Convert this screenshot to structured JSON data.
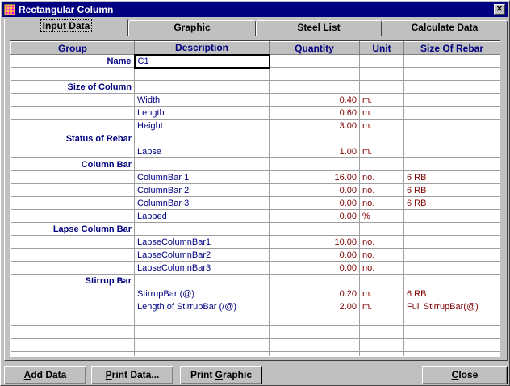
{
  "window": {
    "title": "Rectangular Column",
    "close_label": "✕"
  },
  "tabs": [
    {
      "label": "Input Data",
      "active": true
    },
    {
      "label": "Graphic",
      "active": false
    },
    {
      "label": "Steel List",
      "active": false
    },
    {
      "label": "Calculate Data",
      "active": false
    }
  ],
  "grid": {
    "headers": [
      "Group",
      "Description",
      "Quantity",
      "Unit",
      "Size Of Rebar"
    ],
    "rows": [
      {
        "group": "Name",
        "description": "C1",
        "quantity": "",
        "unit": "",
        "rebar": ""
      },
      {
        "group": "",
        "description": "",
        "quantity": "",
        "unit": "",
        "rebar": ""
      },
      {
        "group": "Size of Column",
        "description": "",
        "quantity": "",
        "unit": "",
        "rebar": ""
      },
      {
        "group": "",
        "description": "Width",
        "quantity": "0.40",
        "unit": "m.",
        "rebar": ""
      },
      {
        "group": "",
        "description": "Length",
        "quantity": "0.60",
        "unit": "m.",
        "rebar": ""
      },
      {
        "group": "",
        "description": "Height",
        "quantity": "3.00",
        "unit": "m.",
        "rebar": ""
      },
      {
        "group": "Status of Rebar",
        "description": "",
        "quantity": "",
        "unit": "",
        "rebar": ""
      },
      {
        "group": "",
        "description": "Lapse",
        "quantity": "1.00",
        "unit": "m.",
        "rebar": ""
      },
      {
        "group": "Column Bar",
        "description": "",
        "quantity": "",
        "unit": "",
        "rebar": ""
      },
      {
        "group": "",
        "description": "ColumnBar 1",
        "quantity": "16.00",
        "unit": "no.",
        "rebar": "6  RB"
      },
      {
        "group": "",
        "description": "ColumnBar 2",
        "quantity": "0.00",
        "unit": "no.",
        "rebar": "6  RB"
      },
      {
        "group": "",
        "description": "ColumnBar 3",
        "quantity": "0.00",
        "unit": "no.",
        "rebar": "6  RB"
      },
      {
        "group": "",
        "description": "Lapped",
        "quantity": "0.00",
        "unit": "%",
        "rebar": ""
      },
      {
        "group": "Lapse Column Bar",
        "description": "",
        "quantity": "",
        "unit": "",
        "rebar": ""
      },
      {
        "group": "",
        "description": "LapseColumnBar1",
        "quantity": "10.00",
        "unit": "no.",
        "rebar": ""
      },
      {
        "group": "",
        "description": "LapseColumnBar2",
        "quantity": "0.00",
        "unit": "no.",
        "rebar": ""
      },
      {
        "group": "",
        "description": "LapseColumnBar3",
        "quantity": "0.00",
        "unit": "no.",
        "rebar": ""
      },
      {
        "group": "Stirrup Bar",
        "description": "",
        "quantity": "",
        "unit": "",
        "rebar": ""
      },
      {
        "group": "",
        "description": "StirrupBar (@)",
        "quantity": "0.20",
        "unit": "m.",
        "rebar": "6  RB"
      },
      {
        "group": "",
        "description": "Length of StirrupBar (/@)",
        "quantity": "2.00",
        "unit": "m.",
        "rebar": "Full StirrupBar(@)"
      },
      {
        "group": "",
        "description": "",
        "quantity": "",
        "unit": "",
        "rebar": ""
      },
      {
        "group": "",
        "description": "",
        "quantity": "",
        "unit": "",
        "rebar": ""
      },
      {
        "group": "",
        "description": "",
        "quantity": "",
        "unit": "",
        "rebar": ""
      },
      {
        "group": "",
        "description": "",
        "quantity": "",
        "unit": "",
        "rebar": ""
      }
    ]
  },
  "buttons": {
    "add_data": {
      "pre": "",
      "mnemonic": "A",
      "post": "dd Data"
    },
    "print_data": {
      "pre": "",
      "mnemonic": "P",
      "post": "rint Data..."
    },
    "print_graphic": {
      "pre": "Print ",
      "mnemonic": "G",
      "post": "raphic"
    },
    "close": {
      "pre": "",
      "mnemonic": "C",
      "post": "lose"
    }
  },
  "colors": {
    "titlebar": "#000080",
    "face": "#c0c0c0",
    "text_blue": "#000080",
    "text_maroon": "#800000"
  }
}
